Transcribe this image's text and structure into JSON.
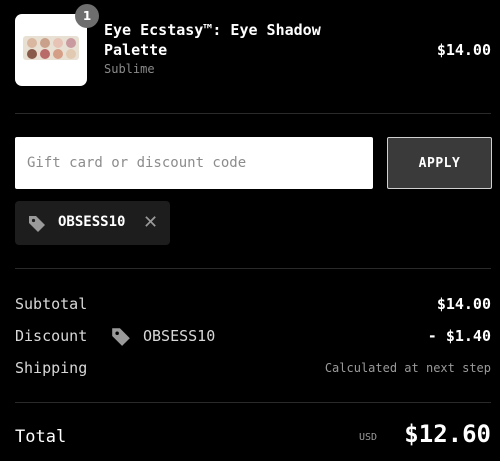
{
  "product": {
    "quantity": "1",
    "name": "Eye Ecstasy™: Eye Shadow Palette",
    "vendor": "Sublime",
    "price": "$14.00",
    "palette_colors": [
      "#d9b7a0",
      "#c9a08a",
      "#e6c3b5",
      "#c99a9f",
      "#8a5a4a",
      "#b96b6a",
      "#d59e86",
      "#e2c9b2"
    ]
  },
  "discount_form": {
    "placeholder": "Gift card or discount code",
    "apply_label": "APPLY"
  },
  "applied_code": {
    "code": "OBSESS10"
  },
  "summary": {
    "subtotal_label": "Subtotal",
    "subtotal_value": "$14.00",
    "discount_label": "Discount",
    "discount_code": "OBSESS10",
    "discount_value": "- $1.40",
    "shipping_label": "Shipping",
    "shipping_value": "Calculated at next step",
    "total_label": "Total",
    "currency": "USD",
    "total_value": "$12.60"
  },
  "colors": {
    "background": "#000000",
    "divider": "#2a2a2a",
    "chip_background": "#1d1d1d",
    "apply_background": "#3a3a3a"
  }
}
